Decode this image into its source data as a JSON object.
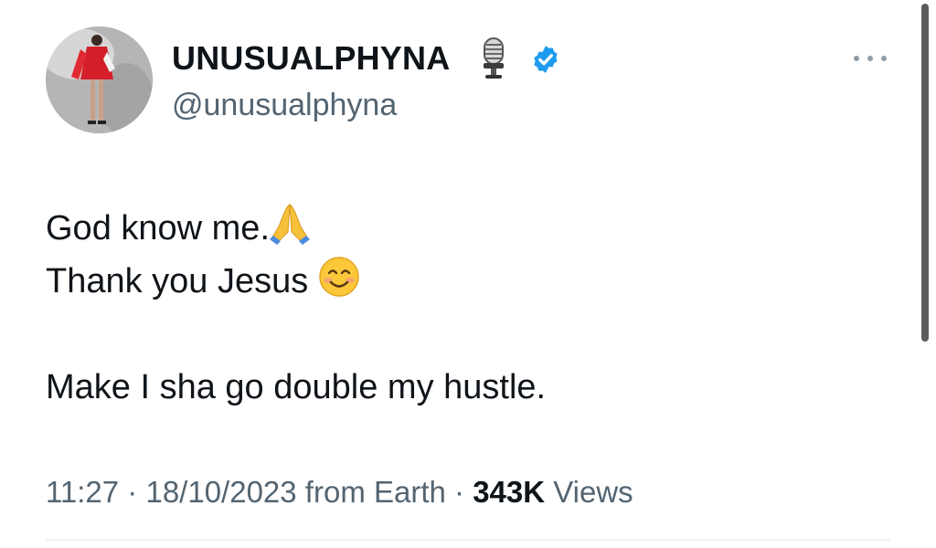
{
  "tweet": {
    "author": {
      "display_name": "UNUSUALPHYNA",
      "handle": "@unusualphyna",
      "badges": [
        "microphone-icon",
        "verified-icon"
      ],
      "verified_color": "#1d9bf0"
    },
    "body": {
      "line1": "God know me.",
      "line1_emoji": "folded-hands-icon",
      "line2": "Thank you Jesus ",
      "line2_emoji": "smiling-face-icon",
      "line3": "Make I sha go double my hustle."
    },
    "meta": {
      "time": "11:27",
      "separator": " · ",
      "date": "18/10/2023",
      "source": " from Earth",
      "views_count": "343K",
      "views_label": " Views"
    },
    "more_icon": "more-dots-icon"
  },
  "colors": {
    "text": "#0f1419",
    "secondary_text": "#536471",
    "verified": "#1d9bf0",
    "divider": "#eff3f4"
  }
}
